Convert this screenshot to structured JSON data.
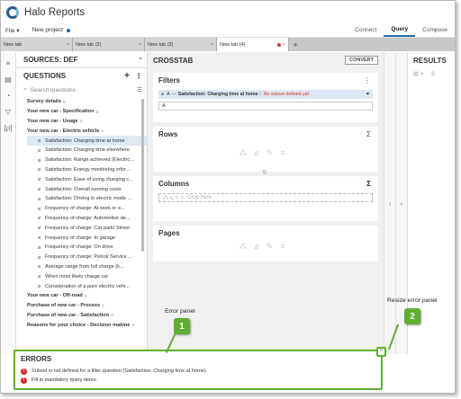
{
  "app": {
    "title": "Halo Reports"
  },
  "menu": {
    "file": "File",
    "new_project": "New project"
  },
  "nav": {
    "connect": "Connect",
    "query": "Query",
    "compose": "Compose"
  },
  "tabs": [
    "New tab",
    "New tab (2)",
    "New tab (3)",
    "New tab (4)"
  ],
  "tab_close": "×",
  "tab_add": "+",
  "sources": {
    "title": "SOURCES: DEF"
  },
  "questions": {
    "title": "QUESTIONS",
    "search_placeholder": "Search questions",
    "items": [
      {
        "label": "Survey details",
        "kind": "folder",
        "count": "6"
      },
      {
        "label": "Your new car - Specification",
        "kind": "folder",
        "count": "5"
      },
      {
        "label": "Your new car - Usage",
        "kind": "folder",
        "count": "3"
      },
      {
        "label": "Your new car - Electric vehicle",
        "kind": "folder",
        "count": "2"
      },
      {
        "label": "Satisfaction: Charging time at home",
        "kind": "child",
        "selected": true
      },
      {
        "label": "Satisfaction: Charging time elsewhere",
        "kind": "child"
      },
      {
        "label": "Satisfaction: Range achieved (Electric...",
        "kind": "child"
      },
      {
        "label": "Satisfaction: Energy monitoring infor...",
        "kind": "child"
      },
      {
        "label": "Satisfaction: Ease of using charging c...",
        "kind": "child"
      },
      {
        "label": "Satisfaction: Overall running costs",
        "kind": "child"
      },
      {
        "label": "Satisfaction: Driving in electric mode ...",
        "kind": "child"
      },
      {
        "label": "Frequency of charge: At work or e...",
        "kind": "child"
      },
      {
        "label": "Frequency of charge: Automotive de...",
        "kind": "child"
      },
      {
        "label": "Frequency of charge: Car park/ Street",
        "kind": "child"
      },
      {
        "label": "Frequency of charge: In garage",
        "kind": "child"
      },
      {
        "label": "Frequency of charge: On drive",
        "kind": "child"
      },
      {
        "label": "Frequency of charge: Petrol/ Service ...",
        "kind": "child"
      },
      {
        "label": "Average range from full charge (k...",
        "kind": "child"
      },
      {
        "label": "When most likely charge car",
        "kind": "child"
      },
      {
        "label": "Consideration of a pure electric vehi...",
        "kind": "child"
      },
      {
        "label": "Your new car - Off-road",
        "kind": "folder",
        "count": "3"
      },
      {
        "label": "Purchase of new car - Process",
        "kind": "folder",
        "count": "7"
      },
      {
        "label": "Purchase of new car - Satisfaction",
        "kind": "folder",
        "count": "2"
      },
      {
        "label": "Reasons for your choice - Decision makine",
        "kind": "folder",
        "count": "4"
      }
    ]
  },
  "crosstab": {
    "title": "CROSSTAB",
    "convert": "CONVERT",
    "filters_title": "Filters",
    "filter_letter": "A",
    "filter_dash": "—",
    "filter_question": "Satisfaction: Charging time at home :",
    "filter_warning": "No subset defined yet",
    "filter_input": "A",
    "rows_title": "Rows",
    "columns_title": "Columns",
    "drop_here": "Drop here",
    "pages_title": "Pages"
  },
  "results": {
    "title": "RESULTS"
  },
  "errors": {
    "title": "ERRORS",
    "items": [
      "Subset is not defined for a filter question (Satisfaction: Charging time at home).",
      "Fill in mandatory query items."
    ]
  },
  "callouts": {
    "error_panel": "Error panel",
    "resize_panel": "Resize error panel",
    "badge1": "1",
    "badge2": "2"
  },
  "colors": {
    "accent": "#2a6fa8",
    "callout": "#5fae33",
    "error": "#d32a2a"
  }
}
